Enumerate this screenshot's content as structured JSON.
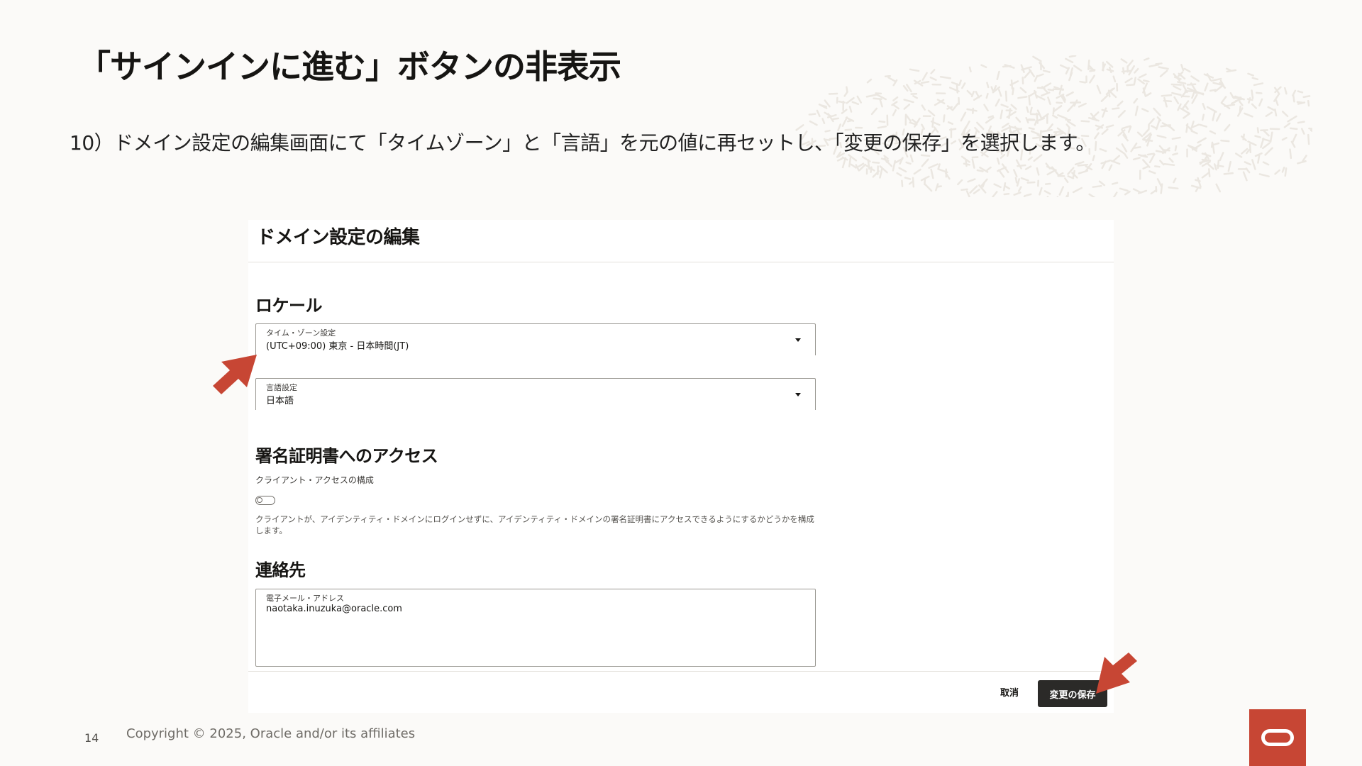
{
  "slide": {
    "title": "「サインインに進む」ボタンの非表示",
    "step_text": "10）ドメイン設定の編集画面にて「タイムゾーン」と「言語」を元の値に再セットし、「変更の保存」を選択します。",
    "page_number": "14",
    "copyright": "Copyright © 2025, Oracle and/or its affiliates"
  },
  "dialog": {
    "title": "ドメイン設定の編集",
    "locale": {
      "heading": "ロケール",
      "timezone": {
        "label": "タイム・ゾーン設定",
        "value": "(UTC+09:00) 東京 - 日本時間(JT)"
      },
      "language": {
        "label": "言語設定",
        "value": "日本語"
      }
    },
    "cert_access": {
      "heading": "署名証明書へのアクセス",
      "toggle_label": "クライアント・アクセスの構成",
      "toggle_on": false,
      "help_text": "クライアントが、アイデンティティ・ドメインにログインせずに、アイデンティティ・ドメインの署名証明書にアクセスできるようにするかどうかを構成します。"
    },
    "contact": {
      "heading": "連絡先",
      "email": {
        "label": "電子メール・アドレス",
        "value": "naotaka.inuzuka@oracle.com"
      }
    },
    "footer": {
      "cancel_label": "取消",
      "save_label": "変更の保存"
    }
  },
  "colors": {
    "accent_red": "#c74634",
    "save_button_bg": "#2b2a28",
    "background": "#fbfaf8"
  },
  "icons": {
    "dropdown": "chevron-down-icon",
    "annotation": "red-arrow-icon",
    "logo": "oracle-logo"
  }
}
